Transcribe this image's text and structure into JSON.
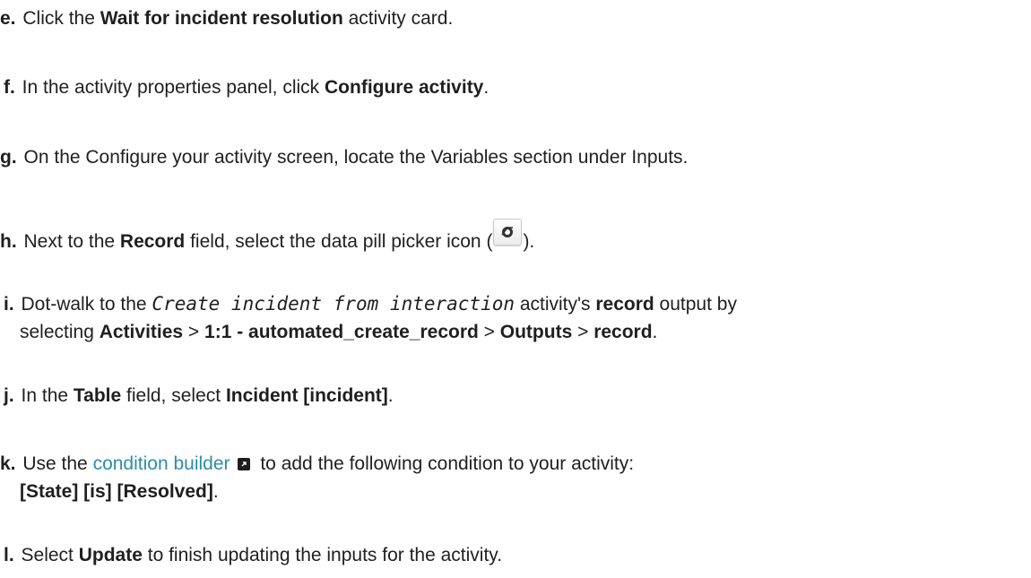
{
  "steps": [
    {
      "letter": "e.",
      "t1": "Click the ",
      "b1": "Wait for incident resolution",
      "t2": " activity card."
    },
    {
      "letter": "f.",
      "t1": "In the activity properties panel, click ",
      "b1": "Configure activity",
      "t2": "."
    },
    {
      "letter": "g.",
      "t1": "On the Configure your activity screen, locate the Variables section under Inputs."
    },
    {
      "letter": "h.",
      "t1": "Next to the ",
      "b1": "Record",
      "t2": " field, select the data pill picker icon (",
      "t3": ")."
    },
    {
      "letter": "i.",
      "t1": "Dot-walk to the ",
      "code": "Create incident from interaction",
      "t2": " activity's ",
      "b1": "record",
      "t3": " output by",
      "t4": "selecting ",
      "b2": "Activities",
      "t5": " > ",
      "b3": "1:1 - automated_create_record",
      "t6": " > ",
      "b4": "Outputs",
      "t7": " > ",
      "b5": "record",
      "t8": "."
    },
    {
      "letter": "j.",
      "t1": "In the ",
      "b1": "Table",
      "t2": " field, select ",
      "b2": "Incident [incident]",
      "t3": "."
    },
    {
      "letter": "k.",
      "t1": "Use the ",
      "link": "condition builder",
      "t2": " to add the following condition to your activity:",
      "b1": "[State] [is] [Resolved]",
      "t3": "."
    },
    {
      "letter": "l.",
      "t1": "Select ",
      "b1": "Update",
      "t2": " to finish updating the inputs for the activity."
    }
  ],
  "icons": {
    "pill_picker": "data-pill-picker-icon",
    "external": "external-link-icon"
  },
  "colors": {
    "link": "#2e8da8",
    "text": "#1f1f1f"
  }
}
